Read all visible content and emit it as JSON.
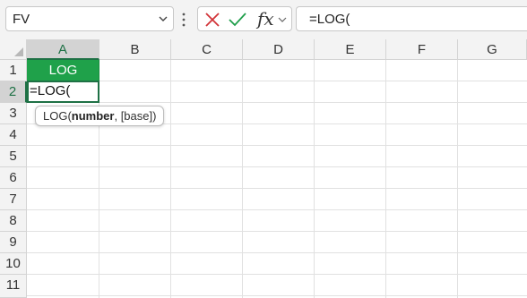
{
  "name_box": {
    "value": "FV"
  },
  "formula_bar": {
    "cancel_icon": "x-icon",
    "enter_icon": "check-icon",
    "fx_label": "fx",
    "formula": "=LOG("
  },
  "columns": [
    "A",
    "B",
    "C",
    "D",
    "E",
    "F",
    "G"
  ],
  "rows": [
    "1",
    "2",
    "3",
    "4",
    "5",
    "6",
    "7",
    "8",
    "9",
    "10",
    "11"
  ],
  "active_column": "A",
  "active_row": "2",
  "cells": {
    "A1": {
      "value": "LOG",
      "fill": "#1fa14a",
      "color": "#ffffff"
    },
    "A2": {
      "value": "=LOG("
    }
  },
  "tooltip": {
    "prefix": "LOG(",
    "arg_bold": "number",
    "rest": ", [base])"
  },
  "colors": {
    "accent": "#1e7145",
    "cancel": "#d13438",
    "enter": "#1e9e4a"
  }
}
